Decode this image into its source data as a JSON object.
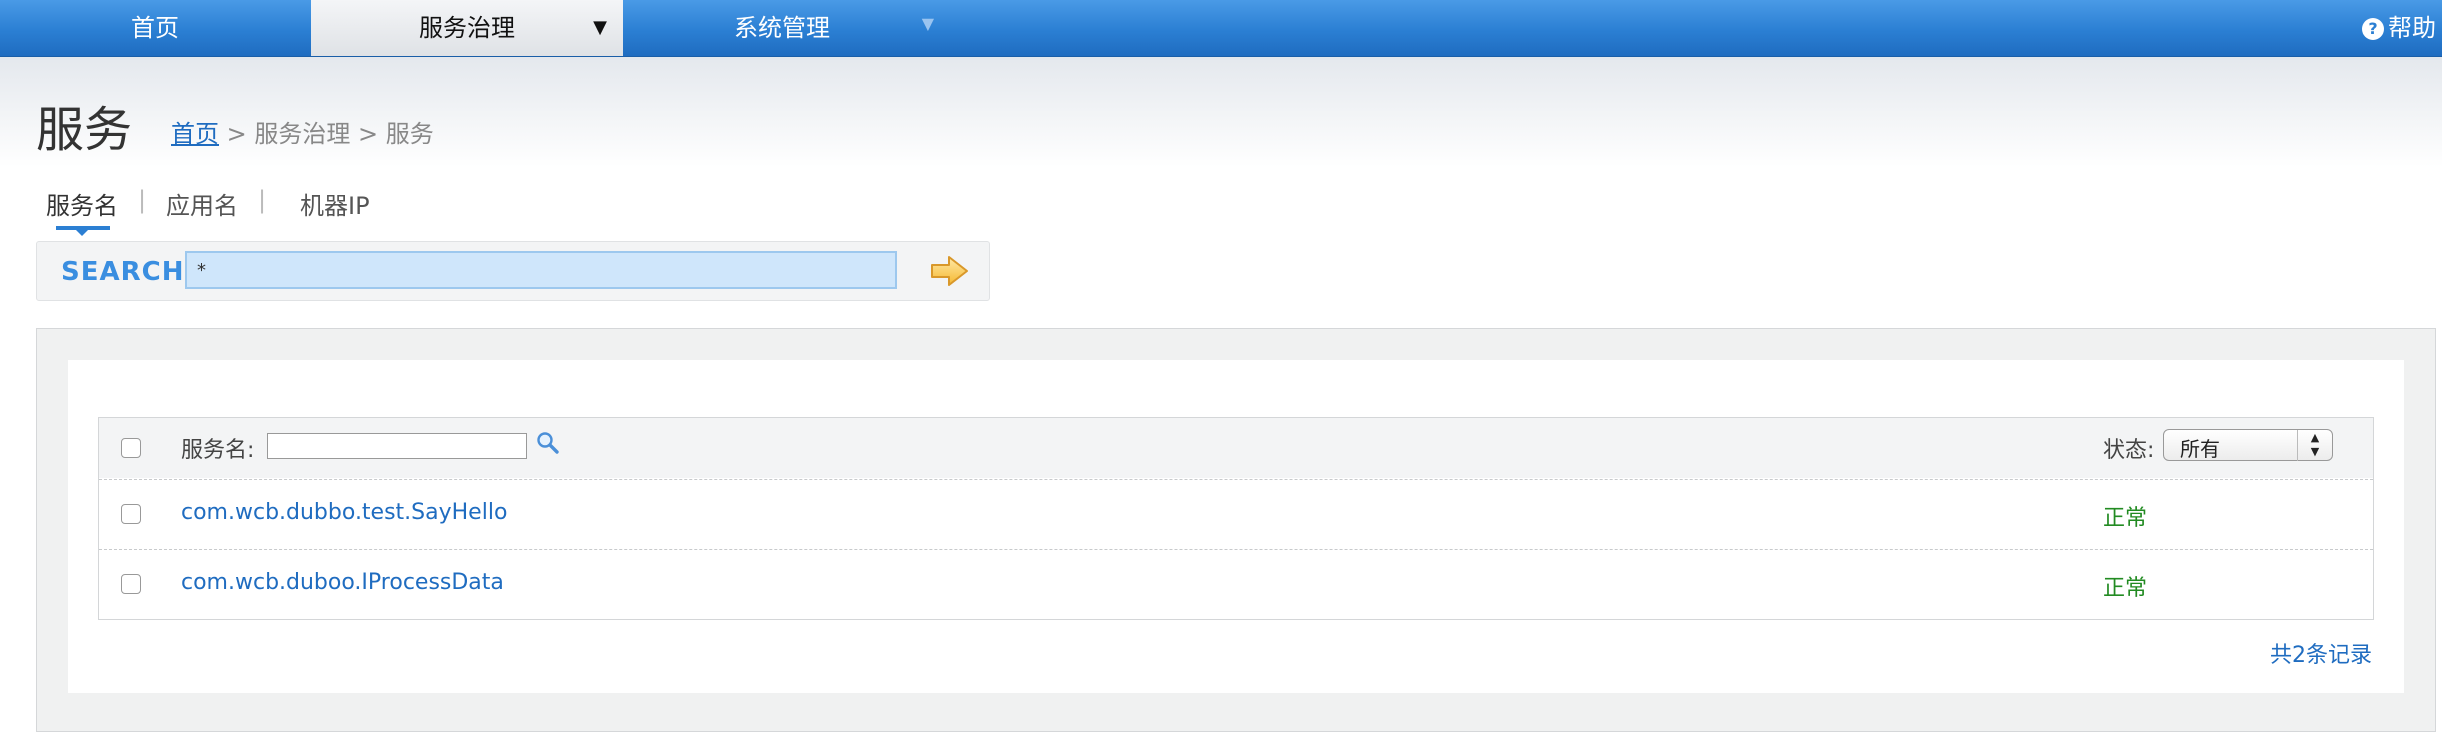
{
  "nav": {
    "items": [
      {
        "label": "首页"
      },
      {
        "label": "服务治理"
      },
      {
        "label": "系统管理"
      }
    ],
    "help_label": "帮助",
    "help_badge": "?"
  },
  "page": {
    "title": "服务",
    "breadcrumb": {
      "home": "首页",
      "sep1": " > ",
      "section": "服务治理",
      "sep2": " > ",
      "current": "服务"
    }
  },
  "search": {
    "tabs": [
      {
        "label": "服务名",
        "active": true
      },
      {
        "label": "应用名",
        "active": false
      },
      {
        "label": "机器IP",
        "active": false
      }
    ],
    "tab_separator": "|",
    "label": "SEARCH",
    "value": "*"
  },
  "table": {
    "header": {
      "name_label": "服务名:",
      "filter_value": "",
      "status_label": "状态:",
      "status_selected": "所有"
    },
    "rows": [
      {
        "name": "com.wcb.dubbo.test.SayHello",
        "status": "正常"
      },
      {
        "name": "com.wcb.duboo.IProcessData",
        "status": "正常"
      }
    ],
    "total": "共2条记录"
  },
  "colors": {
    "nav_blue": "#2b7fd3",
    "link_blue": "#1f6cc0",
    "status_ok": "#228b22",
    "search_fill": "#cfe6fb"
  }
}
